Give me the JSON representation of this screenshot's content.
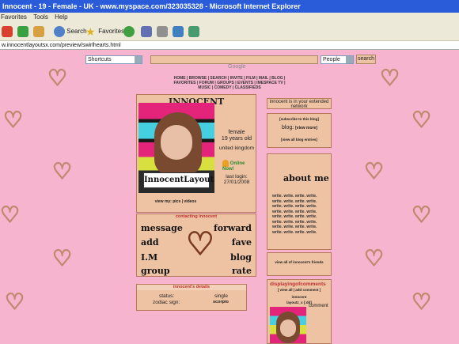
{
  "window": {
    "title": "Innocent - 19 - Female - UK - www.myspace.com/323035328 - Microsoft Internet Explorer"
  },
  "menu": [
    "Favorites",
    "Tools",
    "Help"
  ],
  "toolbar": {
    "search": "Search",
    "favorites": "Favorites"
  },
  "address": "w.innocentlayoutsx.com/preview/swirlhearts.html",
  "searchbar": {
    "shortcuts": "Shortcuts",
    "powered": "Google",
    "people": "People",
    "button": "search"
  },
  "nav": {
    "line1": "HOME | BROWSE | SEARCH | INVITE | FILM | MAIL | BLOG |",
    "line2": "FAVORITES | FORUM | GROUPS | EVENTS | IMESPACE TV |",
    "line3": "MUSIC | COMEDY | CLASSIFIEDS"
  },
  "profile": {
    "name": "INNOCENT",
    "photo_caption": "InnocentLayouts",
    "gender": "female",
    "age": "19 years old",
    "location": "united kingdom",
    "online": "Online Now!",
    "lastlogin_label": "last login:",
    "lastlogin_date": "27/01/2008",
    "viewmy": "view my: pics | videos"
  },
  "contacting": {
    "header": "contacting innocent",
    "message": "message",
    "forward": "forward",
    "add": "add",
    "fave": "fave",
    "im": "I.M",
    "blog": "blog",
    "group": "group",
    "rate": "rate"
  },
  "details": {
    "header": "innocent's details",
    "status_label": "status:",
    "status": "single",
    "zodiac_label": "zodiac sign:",
    "zodiac": "scorpio"
  },
  "right": {
    "network": "innocent is in your extended network",
    "subscribe": "[subscribe to this blog]",
    "blog_label": "blog:",
    "viewmore": "[view more]",
    "viewall": "[view all blog entries]",
    "about": "about me",
    "about_rows": [
      "write. write. write. write.",
      "write. write. write. write.",
      "write. write. write. write.",
      "write. write. write. write.",
      "write. write. write. write.",
      "write. write. write. write.",
      "write. write. write. write.",
      "write. write. write. write."
    ],
    "friends": "view all of innocent's friends",
    "comments_title": "displayingofcomments",
    "comments_links": "[ view all | add comment ]",
    "commenter": "innocent",
    "commenter2": "layoutz_x [:dd]",
    "comment": "comment"
  }
}
